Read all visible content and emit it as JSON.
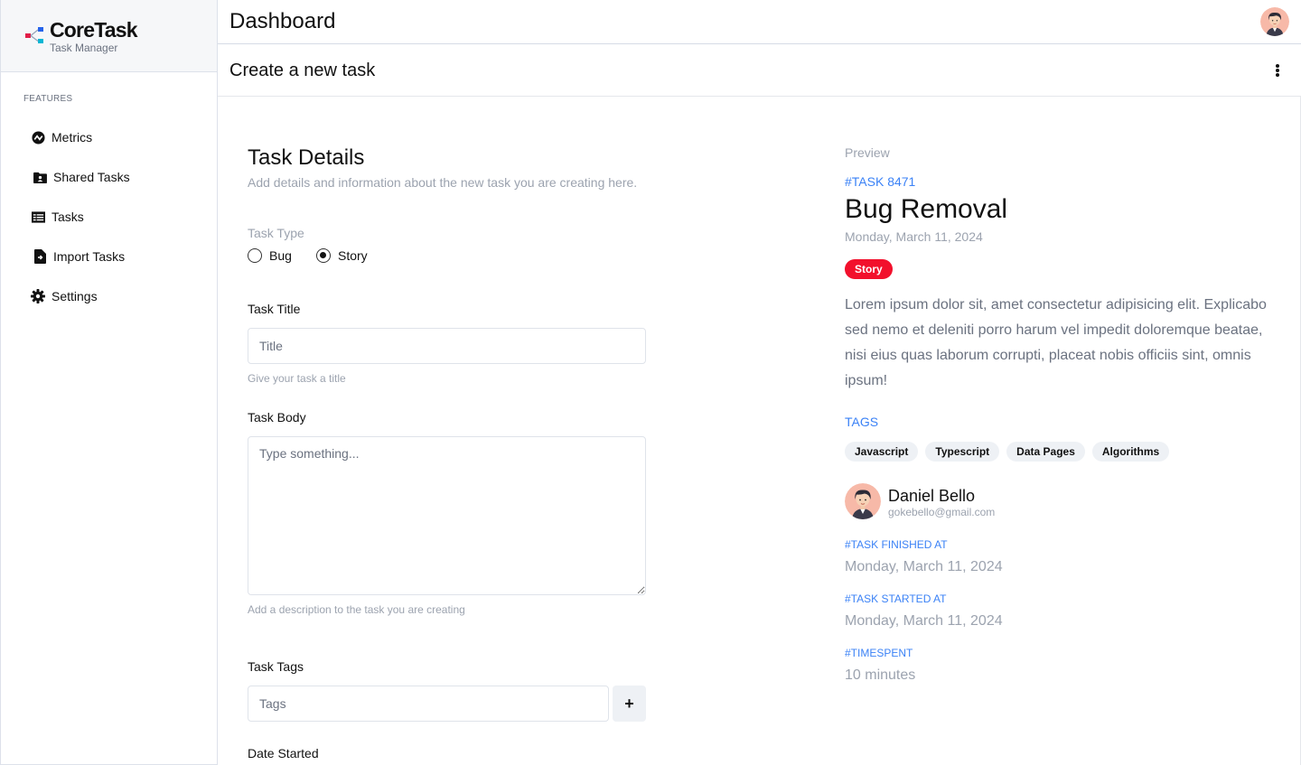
{
  "brand": {
    "name": "CoreTask",
    "subtitle": "Task Manager"
  },
  "sidebar": {
    "section_label": "FEATURES",
    "items": [
      {
        "label": "Metrics",
        "icon": "metrics-icon"
      },
      {
        "label": "Shared Tasks",
        "icon": "folder-user-icon"
      },
      {
        "label": "Tasks",
        "icon": "tasks-list-icon"
      },
      {
        "label": "Import Tasks",
        "icon": "file-import-icon"
      },
      {
        "label": "Settings",
        "icon": "gear-icon"
      }
    ]
  },
  "header": {
    "title": "Dashboard",
    "avatar": "user-avatar"
  },
  "subheader": {
    "title": "Create a new task",
    "menu_icon": "kebab-menu-icon"
  },
  "form": {
    "title": "Task Details",
    "description": "Add details and information about the new task you are creating here.",
    "task_type": {
      "label": "Task Type",
      "options": [
        "Bug",
        "Story"
      ],
      "selected": "Story"
    },
    "task_title": {
      "label": "Task Title",
      "placeholder": "Title",
      "value": "",
      "hint": "Give your task a title"
    },
    "task_body": {
      "label": "Task Body",
      "placeholder": "Type something...",
      "value": "",
      "hint": "Add a description to the task you are creating"
    },
    "task_tags": {
      "label": "Task Tags",
      "placeholder": "Tags",
      "add_label": "+"
    },
    "date_started": {
      "label": "Date Started"
    }
  },
  "preview": {
    "label": "Preview",
    "task_id": "#TASK 8471",
    "title": "Bug Removal",
    "date": "Monday, March 11, 2024",
    "badge": "Story",
    "badge_color": "#f2102c",
    "body": "Lorem ipsum dolor sit, amet consectetur adipisicing elit. Explicabo sed nemo et deleniti porro harum vel impedit doloremque beatae, nisi eius quas laborum corrupti, placeat nobis officiis sint, omnis ipsum!",
    "tags_label": "TAGS",
    "tags": [
      "Javascript",
      "Typescript",
      "Data Pages",
      "Algorithms"
    ],
    "user": {
      "name": "Daniel Bello",
      "email": "gokebello@gmail.com"
    },
    "finished": {
      "label": "#TASK FINISHED AT",
      "value": "Monday, March 11, 2024"
    },
    "started": {
      "label": "#TASK STARTED AT",
      "value": "Monday, March 11, 2024"
    },
    "timespent": {
      "label": "#TIMESPENT",
      "value": "10 minutes"
    }
  },
  "colors": {
    "accent_blue": "#3b82f6",
    "badge_red": "#f2102c",
    "muted": "#9ca3af"
  }
}
